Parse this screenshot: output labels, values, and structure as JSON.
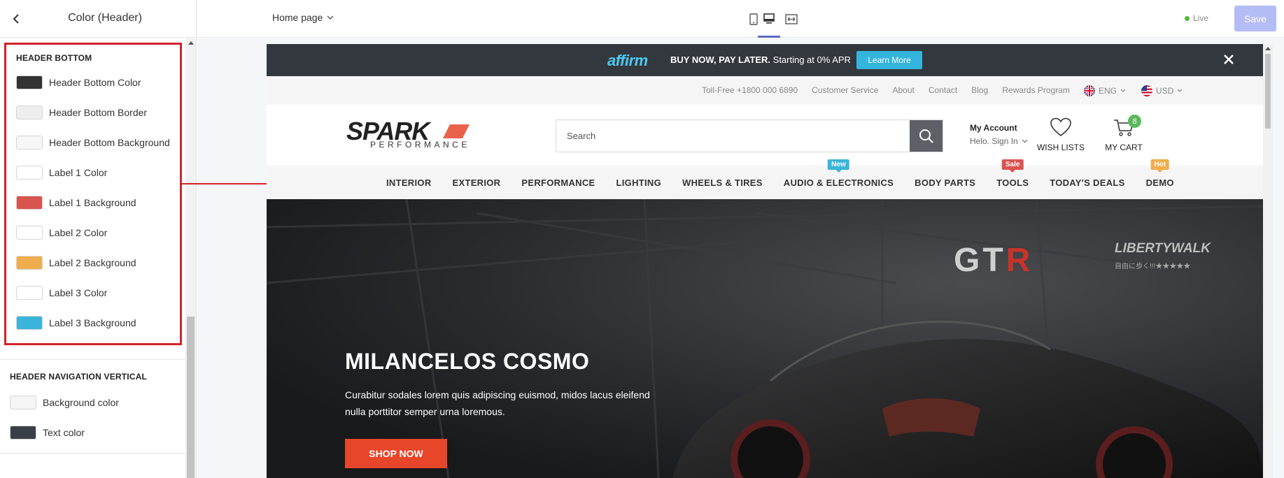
{
  "sidebar": {
    "title": "Color (Header)",
    "groups": {
      "header_bottom": {
        "title": "HEADER BOTTOM",
        "items": [
          {
            "label": "Header Bottom Color",
            "color": "#333333"
          },
          {
            "label": "Header Bottom Border",
            "color": "#eeeeee"
          },
          {
            "label": "Header Bottom Background",
            "color": "#f6f6f6"
          },
          {
            "label": "Label 1 Color",
            "color": "#ffffff"
          },
          {
            "label": "Label 1 Background",
            "color": "#d9534f"
          },
          {
            "label": "Label 2 Color",
            "color": "#ffffff"
          },
          {
            "label": "Label 2 Background",
            "color": "#f0ad4e"
          },
          {
            "label": "Label 3 Color",
            "color": "#ffffff"
          },
          {
            "label": "Label 3 Background",
            "color": "#3bb4d9"
          }
        ]
      },
      "nav_vertical": {
        "title": "HEADER NAVIGATION VERTICAL",
        "items": [
          {
            "label": "Background color",
            "color": "#f5f5f5"
          },
          {
            "label": "Text color",
            "color": "#3a3f47"
          }
        ]
      }
    }
  },
  "toolbar": {
    "page_select": "Home page",
    "live_label": "Live",
    "save_label": "Save"
  },
  "preview": {
    "promo": {
      "logo": "affirm",
      "text_bold": "BUY NOW, PAY LATER.",
      "text_rest": " Starting at 0% APR",
      "button": "Learn More"
    },
    "top_links": [
      "Toll-Free +1800 000 6890",
      "Customer Service",
      "About",
      "Contact",
      "Blog",
      "Rewards Program"
    ],
    "language": "ENG",
    "currency": "USD",
    "logo_text": "SPARK",
    "logo_sub": "PERFORMANCE",
    "search_placeholder": "Search",
    "account": {
      "title": "My Account",
      "sub": "Helo. Sign In"
    },
    "wishlist_label": "WISH LISTS",
    "cart_label": "MY CART",
    "cart_count": "8",
    "nav": [
      {
        "label": "INTERIOR",
        "badge": ""
      },
      {
        "label": "EXTERIOR",
        "badge": ""
      },
      {
        "label": "PERFORMANCE",
        "badge": ""
      },
      {
        "label": "LIGHTING",
        "badge": ""
      },
      {
        "label": "WHEELS & TIRES",
        "badge": ""
      },
      {
        "label": "AUDIO & ELECTRONICS",
        "badge": "New"
      },
      {
        "label": "BODY PARTS",
        "badge": ""
      },
      {
        "label": "TOOLS",
        "badge": "Sale"
      },
      {
        "label": "TODAY'S DEALS",
        "badge": ""
      },
      {
        "label": "DEMO",
        "badge": "Hot"
      }
    ],
    "hero": {
      "title": "MILANCELOS COSMO",
      "text": "Curabitur sodales lorem quis adipiscing euismod, midos lacus eleifend nulla porttitor semper urna loremous.",
      "button": "SHOP NOW",
      "brand_gt": "GT",
      "brand_r": "R",
      "brand_lw": "LIBERTYWALK",
      "brand_lw_sub": "自由に歩く!!!★★★★★"
    }
  },
  "colors": {
    "accent": "#5c6ac4",
    "highlight_border": "#d2232a",
    "promo_bg": "#33383f",
    "shop_now": "#e8462a"
  }
}
